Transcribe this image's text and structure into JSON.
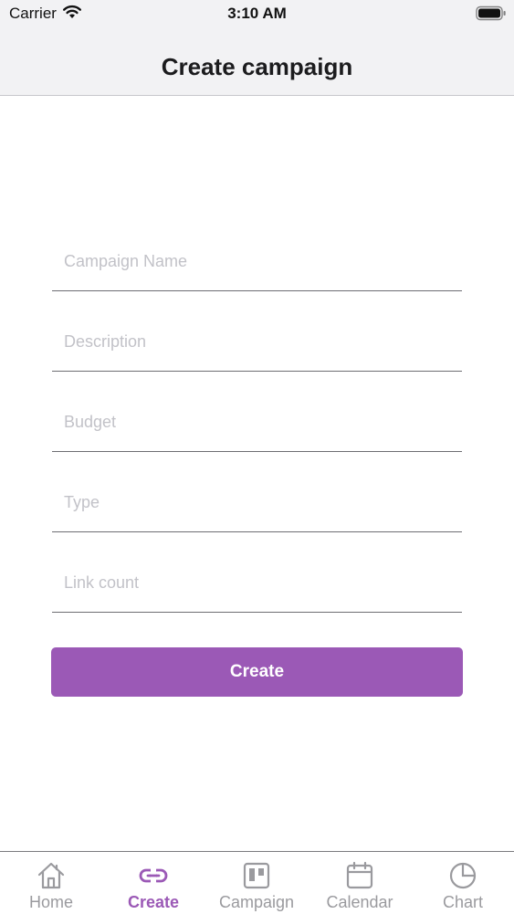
{
  "status_bar": {
    "carrier": "Carrier",
    "time": "3:10 AM"
  },
  "nav": {
    "title": "Create campaign"
  },
  "form": {
    "fields": [
      {
        "placeholder": "Campaign Name",
        "value": ""
      },
      {
        "placeholder": "Description",
        "value": ""
      },
      {
        "placeholder": "Budget",
        "value": ""
      },
      {
        "placeholder": "Type",
        "value": ""
      },
      {
        "placeholder": "Link count",
        "value": ""
      }
    ],
    "submit_label": "Create"
  },
  "tab_bar": {
    "tabs": [
      {
        "label": "Home",
        "icon": "home-icon",
        "active": false
      },
      {
        "label": "Create",
        "icon": "link-icon",
        "active": true
      },
      {
        "label": "Campaign",
        "icon": "board-icon",
        "active": false
      },
      {
        "label": "Calendar",
        "icon": "calendar-icon",
        "active": false
      },
      {
        "label": "Chart",
        "icon": "pie-chart-icon",
        "active": false
      }
    ]
  },
  "colors": {
    "accent": "#9b59b6",
    "inactive_tab": "#9a9a9e",
    "nav_background": "#f2f2f4"
  }
}
